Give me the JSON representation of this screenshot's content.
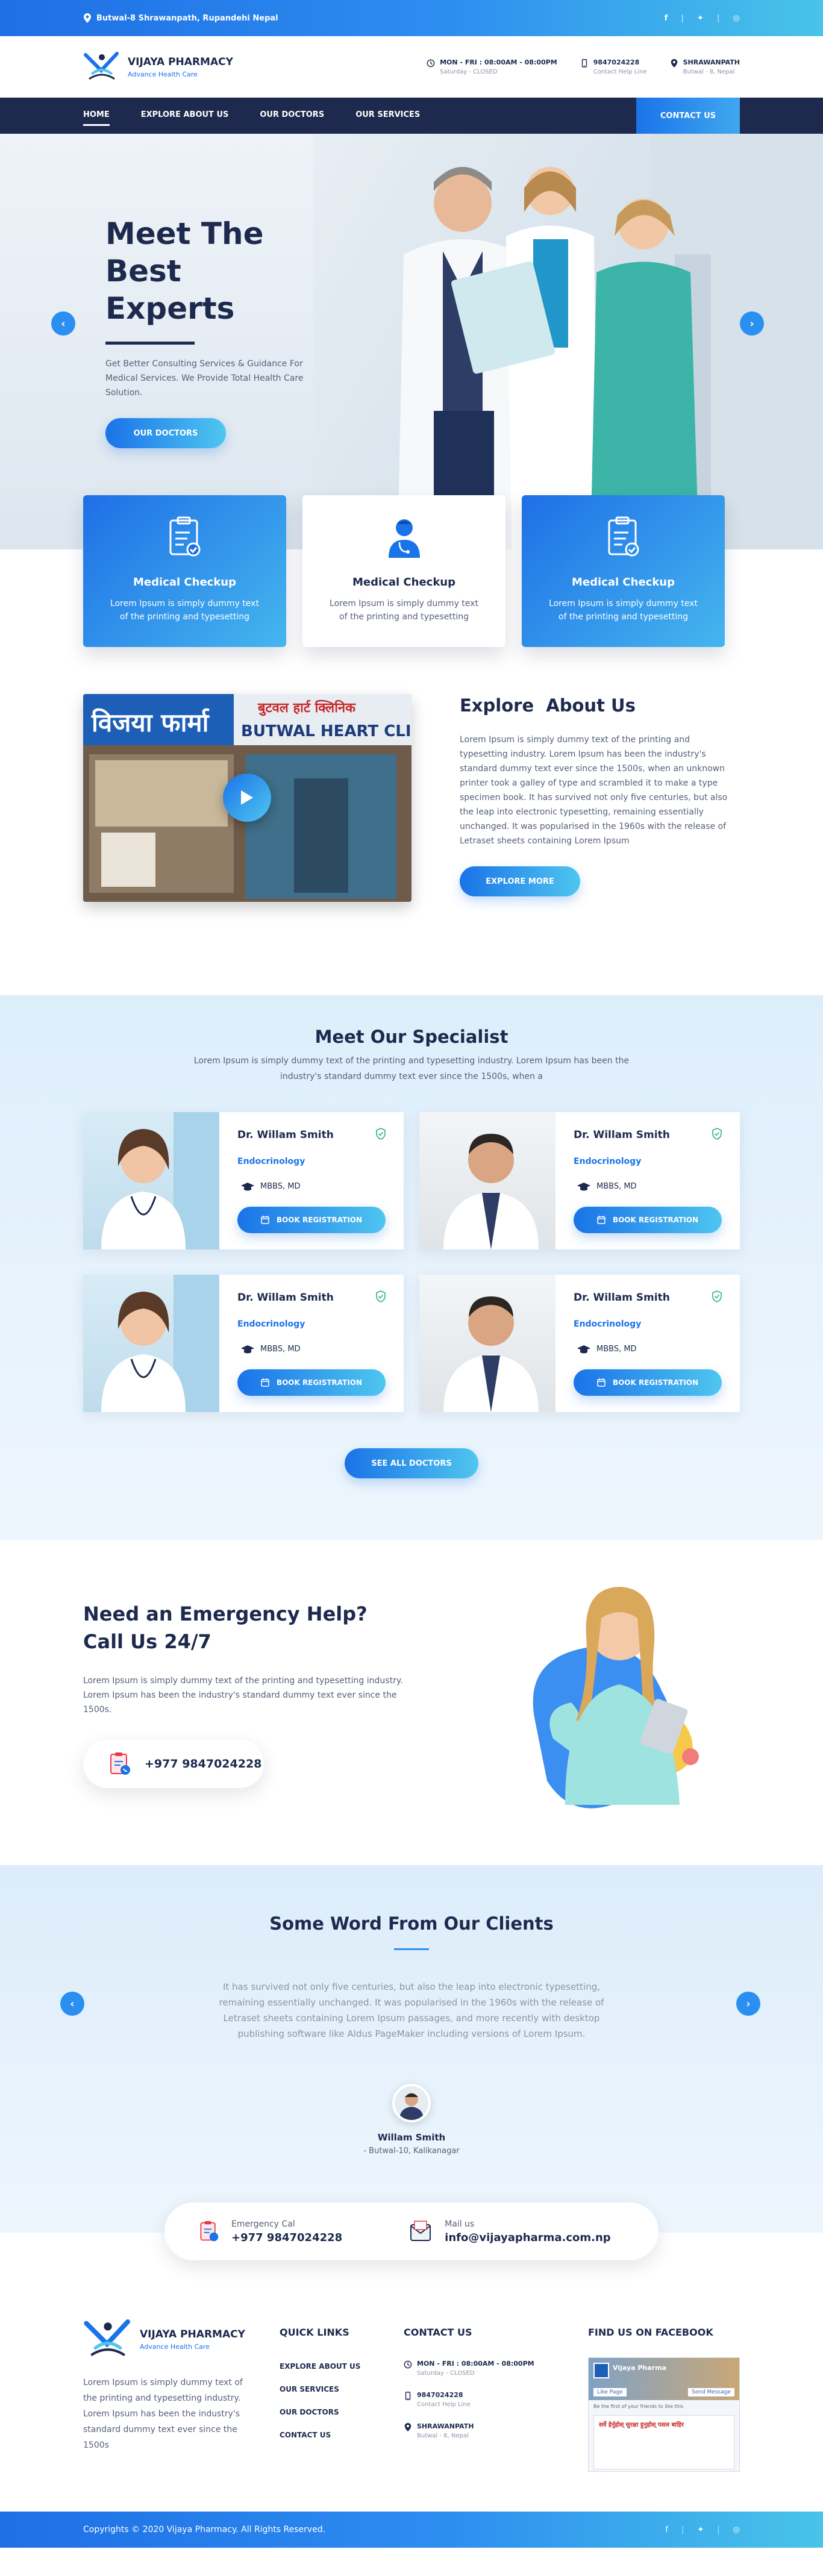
{
  "topbar": {
    "address": "Butwal-8 Shrawanpath, Rupandehi Nepal",
    "social_icons": [
      "facebook-icon",
      "twitter-icon",
      "instagram-icon"
    ]
  },
  "header": {
    "brand_name": "VIJAYA PHARMACY",
    "brand_sub": "Advance Health Care",
    "hours_title": "MON - FRI : 08:00AM - 08:00PM",
    "hours_sub": "Saturday - CLOSED",
    "phone_title": "9847024228",
    "phone_sub": "Contact Help Line",
    "location_title": "SHRAWANPATH",
    "location_sub": "Butwal - 8, Nepal"
  },
  "nav": {
    "items": [
      "HOME",
      "EXPLORE ABOUT US",
      "OUR DOCTORS",
      "OUR SERVICES"
    ],
    "cta": "CONTACT US"
  },
  "hero": {
    "title_line1": "Meet The",
    "title_line2": "Best Experts",
    "description": "Get Better Consulting Services & Guidance For Medical Services. We Provide Total Health Care Solution.",
    "button": "OUR DOCTORS"
  },
  "features": [
    {
      "title": "Medical Checkup",
      "text": "Lorem Ipsum is simply dummy text of the printing and typesetting",
      "style": "blue"
    },
    {
      "title": "Medical Checkup",
      "text": "Lorem Ipsum is simply dummy text of the printing and typesetting",
      "style": "white"
    },
    {
      "title": "Medical Checkup",
      "text": "Lorem Ipsum is simply dummy text of the printing and typesetting",
      "style": "blue"
    }
  ],
  "about": {
    "title": "Explore  About Us",
    "sign_nepali": "विजया फार्मा",
    "sign_nepali2": "बुटवल हार्ट क्लिनिक",
    "sign_english": "BUTWAL HEART CLINIC",
    "description": "Lorem Ipsum is simply dummy text of the printing and typesetting industry. Lorem Ipsum has been the industry's standard dummy text ever since the 1500s, when an unknown printer took a galley of type and scrambled it to make a type specimen book. It has survived not only five centuries, but also the leap into electronic typesetting, remaining essentially unchanged. It was popularised in the 1960s with the release of Letraset sheets containing Lorem Ipsum",
    "button": "EXPLORE MORE"
  },
  "specialist": {
    "title": "Meet Our Specialist",
    "subtitle": "Lorem Ipsum is simply dummy text of the printing and typesetting industry. Lorem Ipsum has been the industry's standard dummy text ever since the 1500s, when a",
    "doctors": [
      {
        "name": "Dr. Willam Smith",
        "specialty": "Endocrinology",
        "degree": "MBBS, MD",
        "button": "BOOK REGISTRATION"
      },
      {
        "name": "Dr. Willam Smith",
        "specialty": "Endocrinology",
        "degree": "MBBS, MD",
        "button": "BOOK REGISTRATION"
      },
      {
        "name": "Dr. Willam Smith",
        "specialty": "Endocrinology",
        "degree": "MBBS, MD",
        "button": "BOOK REGISTRATION"
      },
      {
        "name": "Dr. Willam Smith",
        "specialty": "Endocrinology",
        "degree": "MBBS, MD",
        "button": "BOOK REGISTRATION"
      }
    ],
    "see_all": "SEE ALL DOCTORS"
  },
  "emergency": {
    "title_line1": "Need an Emergency Help?",
    "title_line2": "Call Us 24/7",
    "description": "Lorem Ipsum is simply dummy text of the printing and typesetting industry. Lorem Ipsum has been the industry's standard dummy text ever since the 1500s.",
    "phone": "+977 9847024228"
  },
  "testimonials": {
    "title": "Some Word From Our Clients",
    "quote": "It has survived not only five centuries, but also the leap into electronic typesetting, remaining essentially unchanged. It was popularised in the 1960s with the release of Letraset sheets containing Lorem Ipsum passages, and more recently with desktop publishing software like Aldus PageMaker including versions of Lorem Ipsum.",
    "name": "Willam Smith",
    "location": "- Butwal-10, Kalikanagar"
  },
  "contact_bar": {
    "call_label": "Emergency Cal",
    "call_value": "+977 9847024228",
    "mail_label": "Mail us",
    "mail_value": "info@vijayapharma.com.np"
  },
  "footer": {
    "brand_name": "VIJAYA PHARMACY",
    "brand_sub": "Advance Health Care",
    "description": "Lorem Ipsum is simply dummy text of the printing and typesetting industry. Lorem Ipsum has been the industry's standard dummy text ever since the 1500s",
    "quick_title": "QUICK LINKS",
    "quick_links": [
      "EXPLORE ABOUT US",
      "OUR SERVICES",
      "OUR DOCTORS",
      "CONTACT US"
    ],
    "contact_title": "CONTACT US",
    "hours_title": "MON - FRI : 08:00AM - 08:00PM",
    "hours_sub": "Saturday - CLOSED",
    "phone_title": "9847024228",
    "phone_sub": "Contact Help Line",
    "location_title": "SHRAWANPATH",
    "location_sub": "Butwal - 8, Nepal",
    "facebook_title": "FIND US ON FACEBOOK",
    "fb_page_name": "Vijaya Pharma",
    "fb_like": "Like Page",
    "fb_message": "Send Message",
    "fb_friends": "Be the first of your friends to like this",
    "fb_post": "सर्वे हेर्नुहोस् सुरक्षा हुनुहोस् पसल बाहिर"
  },
  "copyright": {
    "text": "Copyrights © 2020 Vijaya Pharmacy. All Rights Reserved.",
    "social_icons": [
      "facebook-icon",
      "twitter-icon",
      "instagram-icon"
    ]
  },
  "colors": {
    "primary": "#1a73e8",
    "accent": "#4fc6f0",
    "navy": "#1d2a4d",
    "text_muted": "#556079"
  }
}
